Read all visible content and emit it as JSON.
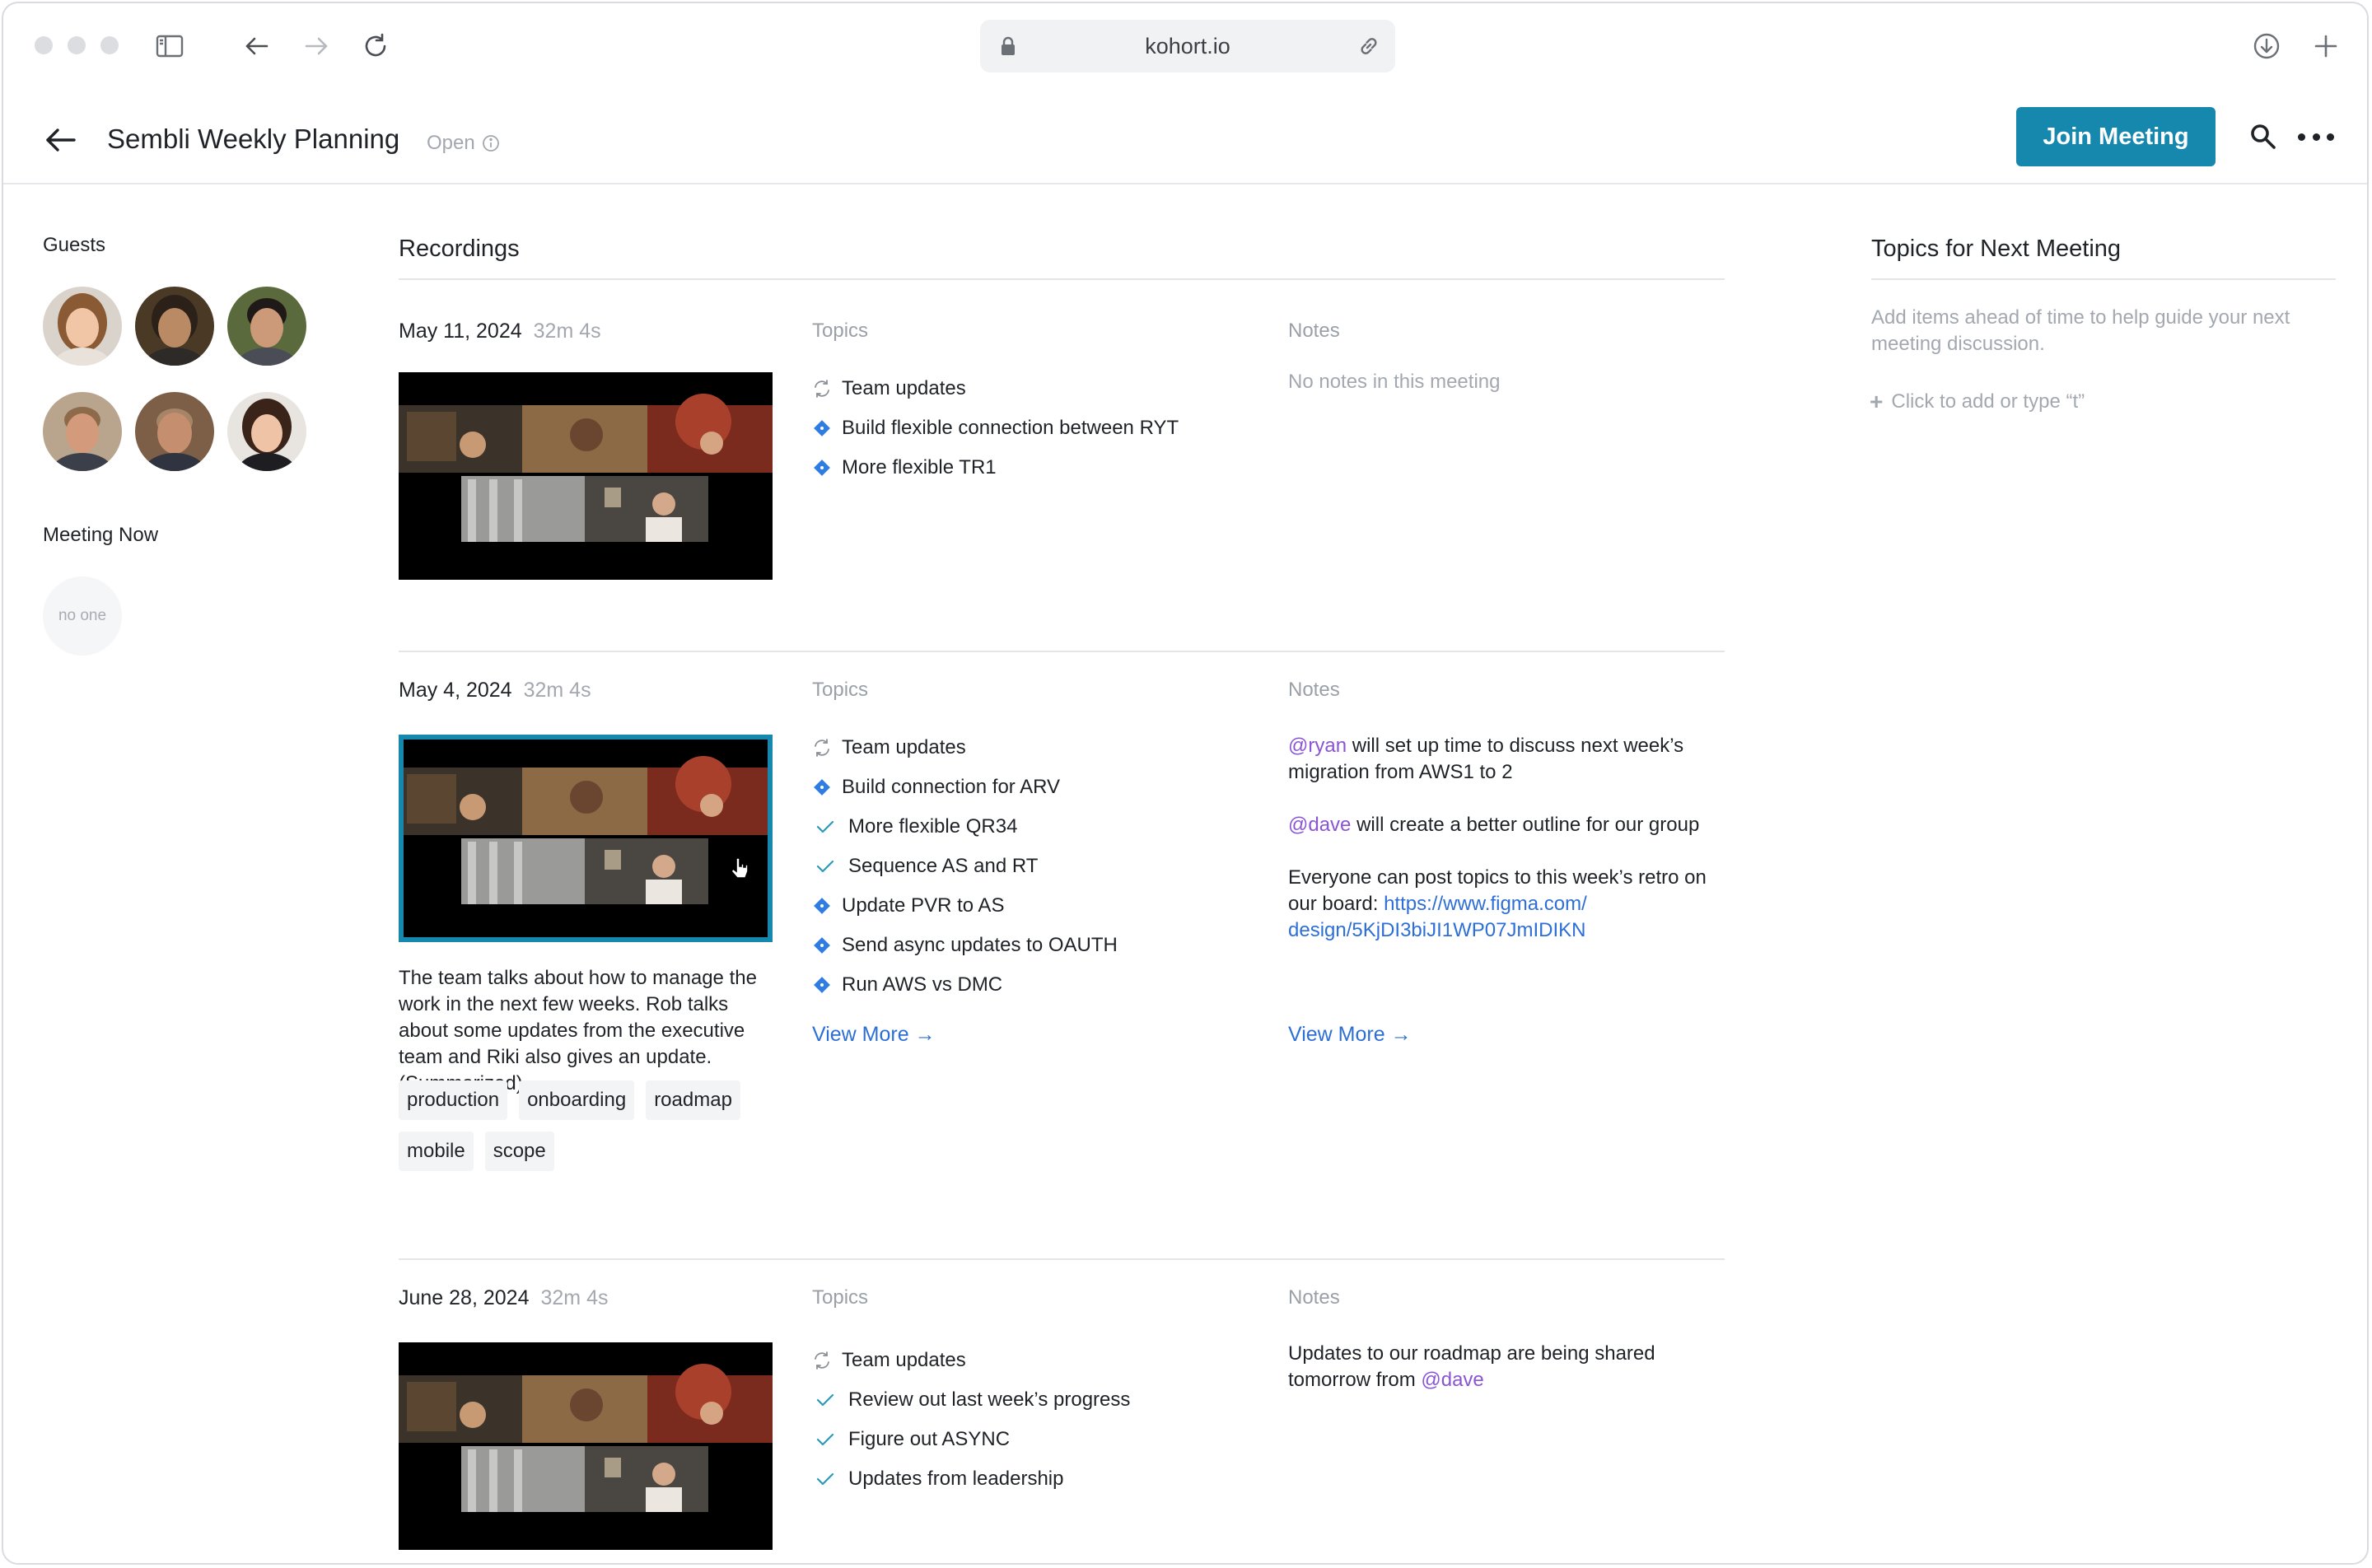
{
  "browser": {
    "url": "kohort.io"
  },
  "header": {
    "title": "Sembli Weekly Planning",
    "status": "Open",
    "join_label": "Join Meeting"
  },
  "sidebar": {
    "guests_label": "Guests",
    "meeting_now_label": "Meeting Now",
    "meeting_now_value": "no one",
    "guests": [
      {
        "icon": "guest-avatar"
      },
      {
        "icon": "guest-avatar"
      },
      {
        "icon": "guest-avatar"
      },
      {
        "icon": "guest-avatar"
      },
      {
        "icon": "guest-avatar"
      },
      {
        "icon": "guest-avatar"
      }
    ]
  },
  "recordings": {
    "title": "Recordings",
    "topics_label": "Topics",
    "notes_label": "Notes",
    "items": [
      {
        "date": "May 11, 2024",
        "duration": "32m 4s",
        "topics": [
          {
            "icon": "sync-icon",
            "label": "Team updates"
          },
          {
            "icon": "diamond-icon",
            "label": "Build flexible connection between RYT"
          },
          {
            "icon": "diamond-icon",
            "label": "More flexible TR1"
          }
        ],
        "notes_empty": "No notes in this meeting"
      },
      {
        "date": "May 4, 2024",
        "duration": "32m 4s",
        "topics": [
          {
            "icon": "sync-icon",
            "label": "Team updates"
          },
          {
            "icon": "diamond-icon",
            "label": "Build connection for ARV"
          },
          {
            "icon": "check-icon",
            "label": "More flexible QR34"
          },
          {
            "icon": "check-icon",
            "label": "Sequence AS and RT"
          },
          {
            "icon": "diamond-icon",
            "label": "Update PVR to AS"
          },
          {
            "icon": "diamond-icon",
            "label": "Send async updates to OAUTH"
          },
          {
            "icon": "diamond-icon",
            "label": "Run AWS vs DMC"
          }
        ],
        "notes": {
          "n1_mention": "@ryan",
          "n1_text": " will set up time to discuss next week’s migration from AWS1 to 2",
          "n2_mention": "@dave",
          "n2_text": " will create a better outline for our group",
          "n3_text": "Everyone can post topics to this week’s retro on our board: ",
          "n3_link_1": "https://www.figma.com/",
          "n3_link_2": "design/5KjDI3biJI1WP07JmIDIKN"
        },
        "view_more_topics": "View More →",
        "view_more_notes": "View More →",
        "summary": "The team talks about how to manage the work in the next few weeks. Rob talks about some updates from the executive team and Riki also gives an update. (Summarized)",
        "tags": [
          "production",
          "onboarding",
          "roadmap",
          "mobile",
          "scope"
        ]
      },
      {
        "date": "June 28, 2024",
        "duration": "32m 4s",
        "topics": [
          {
            "icon": "sync-icon",
            "label": "Team updates"
          },
          {
            "icon": "check-icon",
            "label": "Review out last week’s progress"
          },
          {
            "icon": "check-icon",
            "label": "Figure out ASYNC"
          },
          {
            "icon": "check-icon",
            "label": "Updates from leadership"
          }
        ],
        "notes": {
          "n1_text": "Updates to our roadmap are being shared tomorrow from ",
          "n1_mention": "@dave"
        }
      }
    ]
  },
  "next_meeting": {
    "title": "Topics for Next Meeting",
    "help": "Add items ahead of time to help guide your next meeting discussion.",
    "add_label": "Click to add or type “t”"
  },
  "colors": {
    "accent": "#1788ad",
    "mention": "#8a55d4",
    "link": "#2d6fd6",
    "diamond": "#2f7de1",
    "check": "#2a9ab8"
  }
}
